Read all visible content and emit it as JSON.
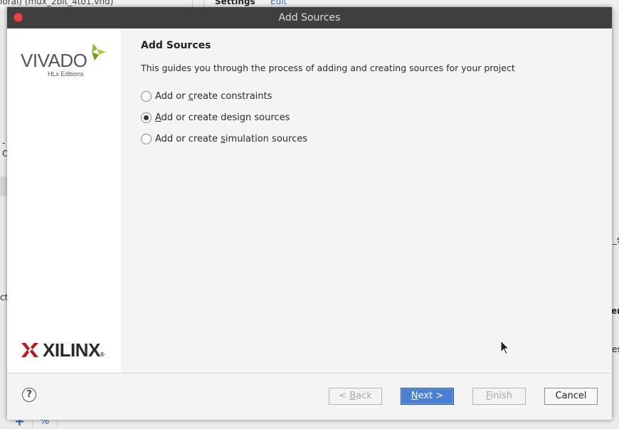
{
  "background": {
    "file_tab": "ioral) (mux_2bit_4to1.vhd)",
    "settings_label": "Settings",
    "edit_link": "Edit",
    "fragments": [
      {
        "id": "frag-dash",
        "text": "-"
      },
      {
        "id": "frag-o",
        "text": "O"
      },
      {
        "id": "frag-ct",
        "text": "ct"
      },
      {
        "id": "frag-s",
        "text": "_s"
      },
      {
        "id": "frag-er",
        "text": "er"
      },
      {
        "id": "frag-es",
        "text": "es"
      }
    ],
    "plus_icon": "+",
    "percent_icon": "%"
  },
  "dialog": {
    "title": "Add Sources",
    "brand": {
      "vivado_word": "VIVADO",
      "vivado_subtitle": "HLx Editions",
      "xilinx_word": "XILINX",
      "xilinx_reg": "®"
    },
    "heading": "Add Sources",
    "description": "This guides you through the process of adding and creating sources for your project",
    "options": [
      {
        "pre": "Add or ",
        "mnemonic": "c",
        "post": "reate constraints",
        "checked": false
      },
      {
        "pre": "",
        "mnemonic": "A",
        "post": "dd or create design sources",
        "checked": true
      },
      {
        "pre": "Add or create ",
        "mnemonic": "s",
        "post": "imulation sources",
        "checked": false
      }
    ],
    "help_label": "?",
    "buttons": {
      "back": {
        "pre": "< ",
        "mnemonic": "B",
        "post": "ack",
        "enabled": false
      },
      "next": {
        "pre": "",
        "mnemonic": "N",
        "post": "ext >",
        "enabled": true
      },
      "finish": {
        "pre": "",
        "mnemonic": "F",
        "post": "inish",
        "enabled": false
      },
      "cancel": {
        "label": "Cancel",
        "enabled": true
      }
    }
  },
  "colors": {
    "titlebar": "#3f3f3f",
    "close_button": "#e84545",
    "primary_button": "#4a7fd6",
    "vivado_leaf": "#8fbf2a"
  }
}
